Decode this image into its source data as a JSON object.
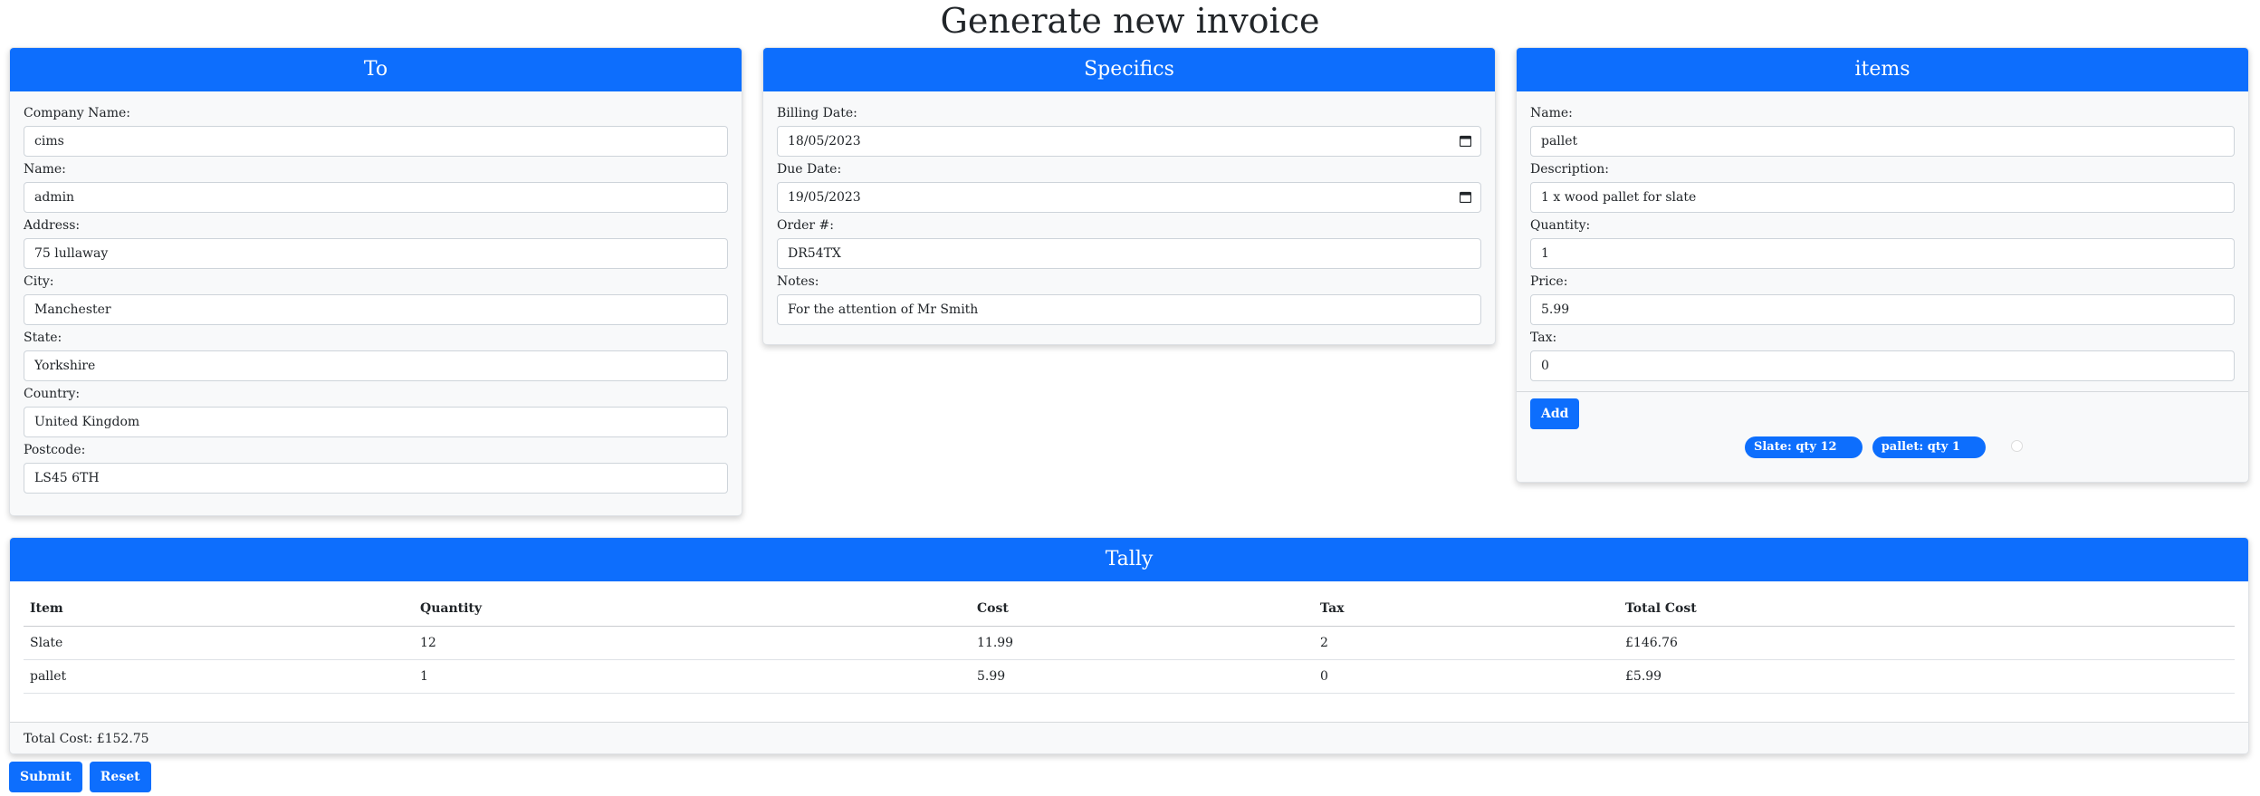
{
  "page": {
    "title": "Generate new invoice"
  },
  "to": {
    "header": "To",
    "fields": [
      {
        "label": "Company Name:",
        "value": "cims"
      },
      {
        "label": "Name:",
        "value": "admin"
      },
      {
        "label": "Address:",
        "value": "75 lullaway"
      },
      {
        "label": "City:",
        "value": "Manchester"
      },
      {
        "label": "State:",
        "value": "Yorkshire"
      },
      {
        "label": "Country:",
        "value": "United Kingdom"
      },
      {
        "label": "Postcode:",
        "value": "LS45 6TH"
      }
    ]
  },
  "specifics": {
    "header": "Specifics",
    "billing_date": {
      "label": "Billing Date:",
      "value": "18/05/2023"
    },
    "due_date": {
      "label": "Due Date:",
      "value": "19/05/2023"
    },
    "order": {
      "label": "Order #:",
      "value": "DR54TX"
    },
    "notes": {
      "label": "Notes:",
      "value": "For the attention of Mr Smith"
    }
  },
  "items": {
    "header": "items",
    "fields": [
      {
        "label": "Name:",
        "value": "pallet"
      },
      {
        "label": "Description:",
        "value": "1 x wood pallet for slate"
      },
      {
        "label": "Quantity:",
        "value": "1"
      },
      {
        "label": "Price:",
        "value": "5.99"
      },
      {
        "label": "Tax:",
        "value": "0"
      }
    ],
    "add_label": "Add",
    "pills": [
      "Slate: qty 12",
      "pallet: qty 1"
    ]
  },
  "tally": {
    "header": "Tally",
    "columns": [
      "Item",
      "Quantity",
      "Cost",
      "Tax",
      "Total Cost"
    ],
    "rows": [
      [
        "Slate",
        "12",
        "11.99",
        "2",
        "£146.76"
      ],
      [
        "pallet",
        "1",
        "5.99",
        "0",
        "£5.99"
      ]
    ],
    "total_label": "Total Cost: £152.75"
  },
  "actions": {
    "submit_label": "Submit",
    "reset_label": "Reset"
  },
  "colors": {
    "primary": "#0d6efd",
    "card_bg": "#f8f9fa"
  }
}
